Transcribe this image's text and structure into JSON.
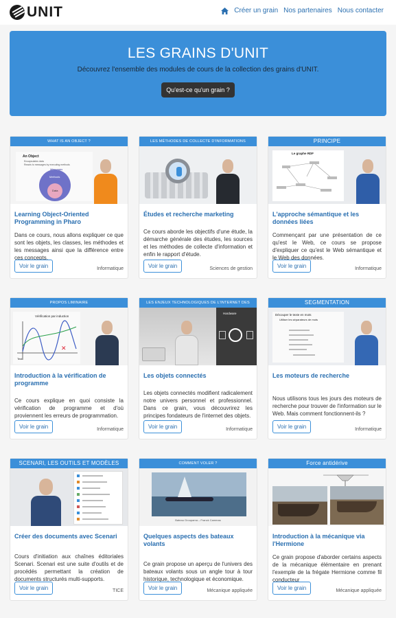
{
  "header": {
    "logo_text": "UNIT",
    "nav": [
      "Créer un grain",
      "Nos partenaires",
      "Nous contacter"
    ]
  },
  "hero": {
    "title": "LES GRAINS D'UNIT",
    "subtitle": "Découvrez l'ensemble des modules de cours de la collection des grains d'UNIT.",
    "button": "Qu'est-ce qu'un grain ?"
  },
  "colors": {
    "accent": "#3b8fd9",
    "link": "#2a6fb0",
    "dark_button": "#333333"
  },
  "cards": [
    {
      "banner": "What is an object ?",
      "title": "Learning Object-Oriented Programming in Pharo",
      "desc": "Dans ce cours, nous allons expliquer ce que sont les objets, les classes, les méthodes et les messages ainsi que la différence entre ces concepts.",
      "button": "Voir le grain",
      "category": "Informatique",
      "thumb_text": [
        "An Object",
        "Encapsulates data",
        "Reacts to messages by executing methods",
        "Messages",
        "Methods",
        "Data"
      ]
    },
    {
      "banner": "Les méthodes de collecte d'informations",
      "title": "Études et recherche marketing",
      "desc": "Ce cours aborde les objectifs d'une étude, la démarche générale des études, les sources et les méthodes de collecte d'information et enfin le rapport d'étude.",
      "button": "Voir le grain",
      "category": "Sciences de gestion"
    },
    {
      "banner": "Principe",
      "title": "L'approche sémantique et les données liées",
      "desc": "Commençant par une présentation de ce qu'est le Web, ce cours se propose d'expliquer ce qu'est le Web sémantique et le Web des données.",
      "button": "Voir le grain",
      "category": "Informatique",
      "thumb_text": [
        "Le graphe RDF"
      ]
    },
    {
      "banner": "Propos liminaire",
      "title": "Introduction à la vérification de programme",
      "desc": "Ce cours explique en quoi consiste la vérification de programme et d'où proviennent les erreurs de programmation.",
      "button": "Voir le grain",
      "category": "Informatique",
      "thumb_text": [
        "Vérification par induction",
        "Test"
      ]
    },
    {
      "banner": "Les enjeux technologiques de l'internet des objets",
      "title": "Les objets connectés",
      "desc": "Les objets connectés modifient radicalement notre univers personnel et professionnel. Dans ce grain, vous découvrirez les principes fondateurs de l'internet des objets.",
      "button": "Voir le grain",
      "category": "Informatique",
      "thumb_text": [
        "Hardware"
      ]
    },
    {
      "banner": "Segmentation",
      "title": "Les moteurs de recherche",
      "desc": "Nous utilisons tous les jours des moteurs de recherche pour trouver de l'information sur le Web. Mais comment fonctionnent-ils ?",
      "button": "Voir le grain",
      "category": "Informatique",
      "thumb_text": [
        "Découper le texte en mots",
        "Utiliser les séparateurs de mots"
      ]
    },
    {
      "banner": "Scenari, les outils et modèles",
      "title": "Créer des documents avec Scenari",
      "desc": "Cours d'initiation aux chaînes éditoriales Scenari. Scenari est une suite d'outils et de procédés permettant la création de documents structurés multi-supports.",
      "button": "Voir le grain",
      "category": "TICE"
    },
    {
      "banner": "Comment voler ?",
      "title": "Quelques aspects des bateaux volants",
      "desc": "Ce grain propose un aperçu de l'univers des bateaux volants sous un angle tour à tour historique, technologique et économique.",
      "button": "Voir le grain",
      "category": "Mécanique appliquée",
      "thumb_text": [
        "Bateau Groupama – Franck Cammas"
      ]
    },
    {
      "banner": "Force antidérive",
      "title": "Introduction à la mécanique via l'Hermione",
      "desc": "Ce grain propose d'aborder certains aspects de la mécanique élémentaire en prenant l'exemple de la frégate Hermione comme fil conducteur",
      "button": "Voir le grain",
      "category": "Mécanique appliquée"
    }
  ]
}
